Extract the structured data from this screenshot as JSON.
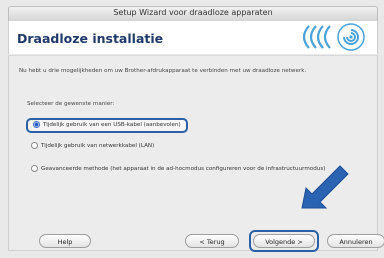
{
  "window": {
    "title": "Setup Wizard voor draadloze apparaten"
  },
  "header": {
    "heading": "Draadloze installatie"
  },
  "body": {
    "intro": "Nu hebt u drie mogelijkheden om uw Brother-afdrukapparaat te verbinden met uw draadloze netwerk.",
    "prompt": "Selecteer de gewenste manier:",
    "options": [
      {
        "label": "Tijdelijk gebruik van een USB-kabel (aanbevolen)",
        "selected": true
      },
      {
        "label": "Tijdelijk gebruik van netwerkkabel (LAN)",
        "selected": false
      },
      {
        "label": "Geavanceerde methode (het apparaat in de ad-hocmodus configureren voor de infrastructuurmodus)",
        "selected": false
      }
    ]
  },
  "buttons": {
    "help": "Help",
    "back": "< Terug",
    "next": "Volgende >",
    "cancel": "Annuleren"
  },
  "colors": {
    "accent": "#2b5fa8",
    "heading": "#1f3a6a"
  },
  "icons": {
    "logo": "wifi-brother-logo-icon",
    "pointer": "arrow-pointer-icon"
  }
}
